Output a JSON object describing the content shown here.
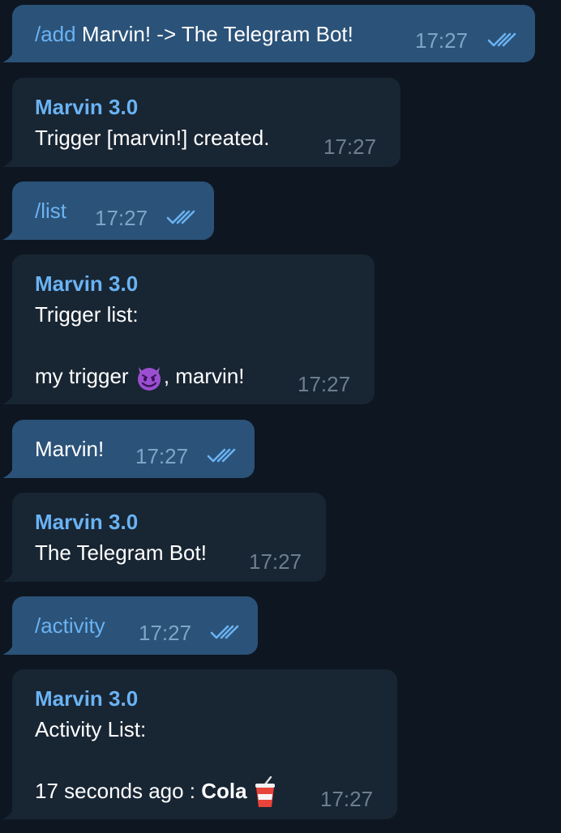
{
  "colors": {
    "background": "#0e1621",
    "outgoing_bubble": "#2b5278",
    "incoming_bubble": "#182533",
    "link_blue": "#6ab3f3"
  },
  "messages": [
    {
      "type": "outgoing",
      "command": "/add",
      "text": " Marvin! -> The Telegram Bot!",
      "time": "17:27",
      "status": "read"
    },
    {
      "type": "incoming",
      "sender": "Marvin 3.0",
      "lines": [
        "Trigger [marvin!] created."
      ],
      "time": "17:27"
    },
    {
      "type": "outgoing",
      "command": "/list",
      "text": "",
      "time": "17:27",
      "status": "read"
    },
    {
      "type": "incoming",
      "sender": "Marvin 3.0",
      "lines": [
        "Trigger list:",
        "",
        "my trigger",
        ", marvin!"
      ],
      "emoji": "smiling-imp-emoji",
      "time": "17:27"
    },
    {
      "type": "outgoing",
      "command": "",
      "text": "Marvin!",
      "time": "17:27",
      "status": "read"
    },
    {
      "type": "incoming",
      "sender": "Marvin 3.0",
      "lines": [
        "The Telegram Bot!"
      ],
      "time": "17:27"
    },
    {
      "type": "outgoing",
      "command": "/activity",
      "text": "",
      "time": "17:27",
      "status": "read"
    },
    {
      "type": "incoming",
      "sender": "Marvin 3.0",
      "lines": [
        "Activity List:",
        "",
        "17 seconds ago : ",
        "Cola"
      ],
      "emoji": "cup-with-straw-emoji",
      "time": "17:27"
    }
  ]
}
